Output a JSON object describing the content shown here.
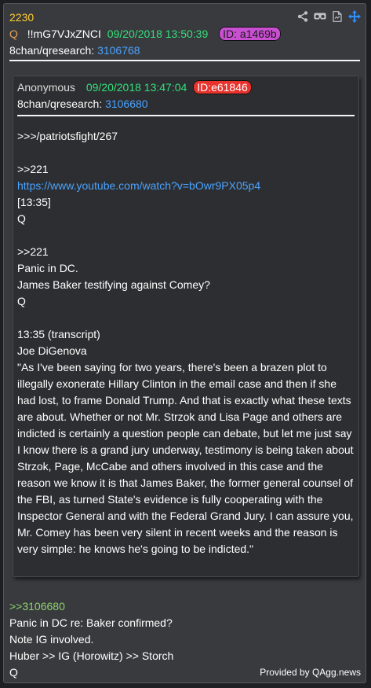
{
  "post": {
    "number": "2230",
    "q_marker": "Q",
    "tripcode": "!!mG7VJxZNCI",
    "timestamp": "09/20/2018 13:50:39",
    "id_label": "ID: a1469b",
    "board": "8chan/qresearch:",
    "thread_link": "3106768"
  },
  "toolbar": {
    "icons": [
      "share-icon",
      "vr-glasses-icon",
      "document-icon",
      "move-icon"
    ]
  },
  "quoted": {
    "author": "Anonymous",
    "timestamp": "09/20/2018 13:47:04",
    "id_label": "ID:e61846",
    "board": "8chan/qresearch:",
    "thread_link": "3106680",
    "lines": {
      "l1": ">>>/patriotsfight/267",
      "l2": ">>221",
      "l3": "https://www.youtube.com/watch?v=bOwr9PX05p4",
      "l4": "[13:35]",
      "l5": "Q",
      "l6": ">>221",
      "l7": "Panic in DC.",
      "l8": "James Baker testifying against Comey?",
      "l9": "Q",
      "l10": "13:35 (transcript)",
      "l11": "Joe DiGenova",
      "quote": "\"As I've been saying for two years, there's been a brazen plot to illegally exonerate Hillary Clinton in the email case and then if she had lost, to frame Donald Trump. And that is exactly what these texts are about. Whether or not Mr. Strzok and Lisa Page and others are indicted is certainly a question people can debate, but let me just say I know there is a grand jury underway, testimony is being taken about Strzok, Page, McCabe and others involved in this case and the reason we know it is that James Baker, the former general counsel of the FBI, as turned State's evidence is fully cooperating with the Inspector General and with the Federal Grand Jury. I can assure you, Mr. Comey has been very silent in recent weeks and the reason is very simple: he knows he's going to be indicted.\""
    }
  },
  "reply": {
    "ref": ">>3106680",
    "l1": "Panic in DC re: Baker confirmed?",
    "l2": "Note IG involved.",
    "l3": "Huber >> IG (Horowitz) >> Storch",
    "l4": "Q"
  },
  "credit": "Provided by QAgg.news",
  "colors": {
    "post_number": "#ffcc33",
    "timestamp": "#33e07a",
    "link": "#4aa3ff",
    "id_pill": "#c94fd1",
    "id_pill_quoted": "#e8332d",
    "greentext": "#8ed36f"
  }
}
